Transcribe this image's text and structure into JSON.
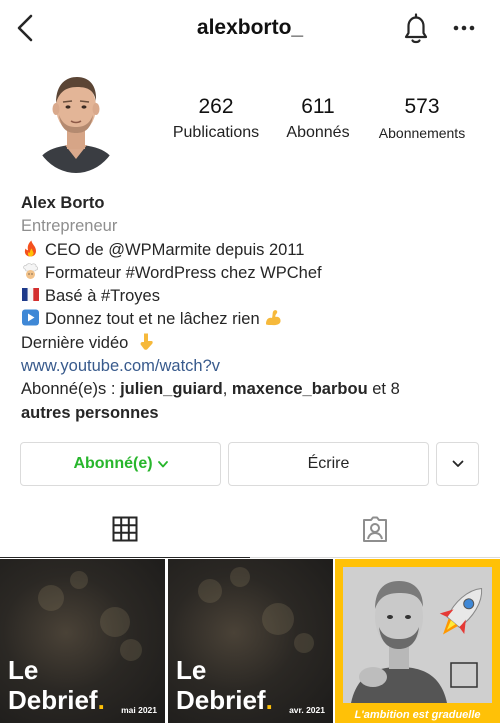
{
  "header": {
    "username": "alexborto_",
    "back_icon": "chevron-left-icon",
    "notification_icon": "bell-icon",
    "more_icon": "ellipsis-icon"
  },
  "stats": {
    "posts": {
      "count": "262",
      "label": "Publications"
    },
    "followers": {
      "count": "611",
      "label": "Abonnés"
    },
    "following": {
      "count": "573",
      "label": "Abonnements"
    }
  },
  "bio": {
    "name": "Alex Borto",
    "category": "Entrepreneur",
    "lines": [
      {
        "emoji": "fire-icon",
        "text": "CEO de @WPMarmite depuis 2011"
      },
      {
        "emoji": "chef-icon",
        "text": "Formateur #WordPress chez WPChef"
      },
      {
        "emoji": "france-flag-icon",
        "text": "Basé à #Troyes"
      },
      {
        "emoji": "play-button-icon",
        "text": "Donnez tout et ne lâchez rien",
        "trailing_emoji": "flexed-biceps-icon"
      }
    ],
    "last_video": "Dernière vidéo",
    "last_video_emoji": "pointing-down-icon",
    "link": "www.youtube.com/watch?v",
    "followed_by": {
      "prefix": "Abonné(e)s : ",
      "user1": "julien_guiard",
      "sep": ", ",
      "user2": "maxence_barbou",
      "suffix": " et 8",
      "more": "autres personnes"
    }
  },
  "actions": {
    "follow_label": "Abonné(e)",
    "message_label": "Écrire",
    "follow_color": "#28b62c"
  },
  "tabs": {
    "grid_icon": "grid-icon",
    "tagged_icon": "tagged-person-icon"
  },
  "posts": [
    {
      "title_line1": "Le",
      "title_line2": "Debrief",
      "dot": ".",
      "date": "mai 2021"
    },
    {
      "title_line1": "Le",
      "title_line2": "Debrief",
      "dot": ".",
      "date": "avr. 2021"
    },
    {
      "caption": "L'ambition est graduelle",
      "icon": "rocket-icon",
      "accent": "#ffc107"
    }
  ]
}
